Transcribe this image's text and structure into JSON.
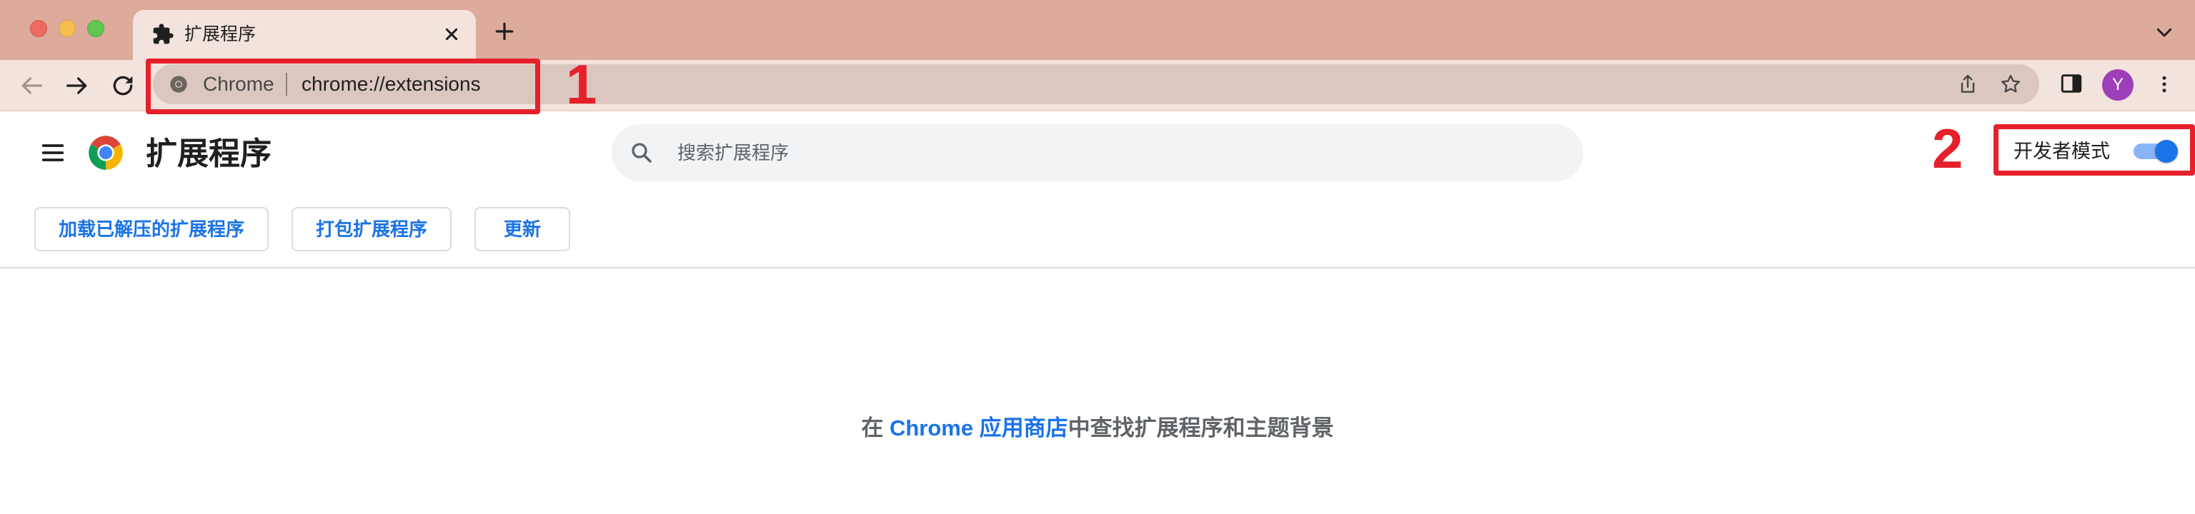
{
  "browser": {
    "tab": {
      "title": "扩展程序"
    },
    "omnibox": {
      "site_label": "Chrome",
      "url": "chrome://extensions"
    },
    "profile_initial": "Y"
  },
  "extensions_page": {
    "title": "扩展程序",
    "search_placeholder": "搜索扩展程序",
    "developer_mode_label": "开发者模式",
    "developer_mode_on": true,
    "buttons": {
      "load_unpacked": "加载已解压的扩展程序",
      "pack_extension": "打包扩展程序",
      "update": "更新"
    },
    "empty_message": {
      "prefix": "在 ",
      "link": "Chrome 应用商店",
      "suffix": "中查找扩展程序和主题背景"
    }
  },
  "annotations": {
    "box1_number": "1",
    "box2_number": "2",
    "color": "#e5202b"
  },
  "colors": {
    "tabstrip": "#dcab9b",
    "toolbar": "#f3e3dd",
    "accent": "#1a73e8",
    "avatar": "#9c3fb8"
  }
}
